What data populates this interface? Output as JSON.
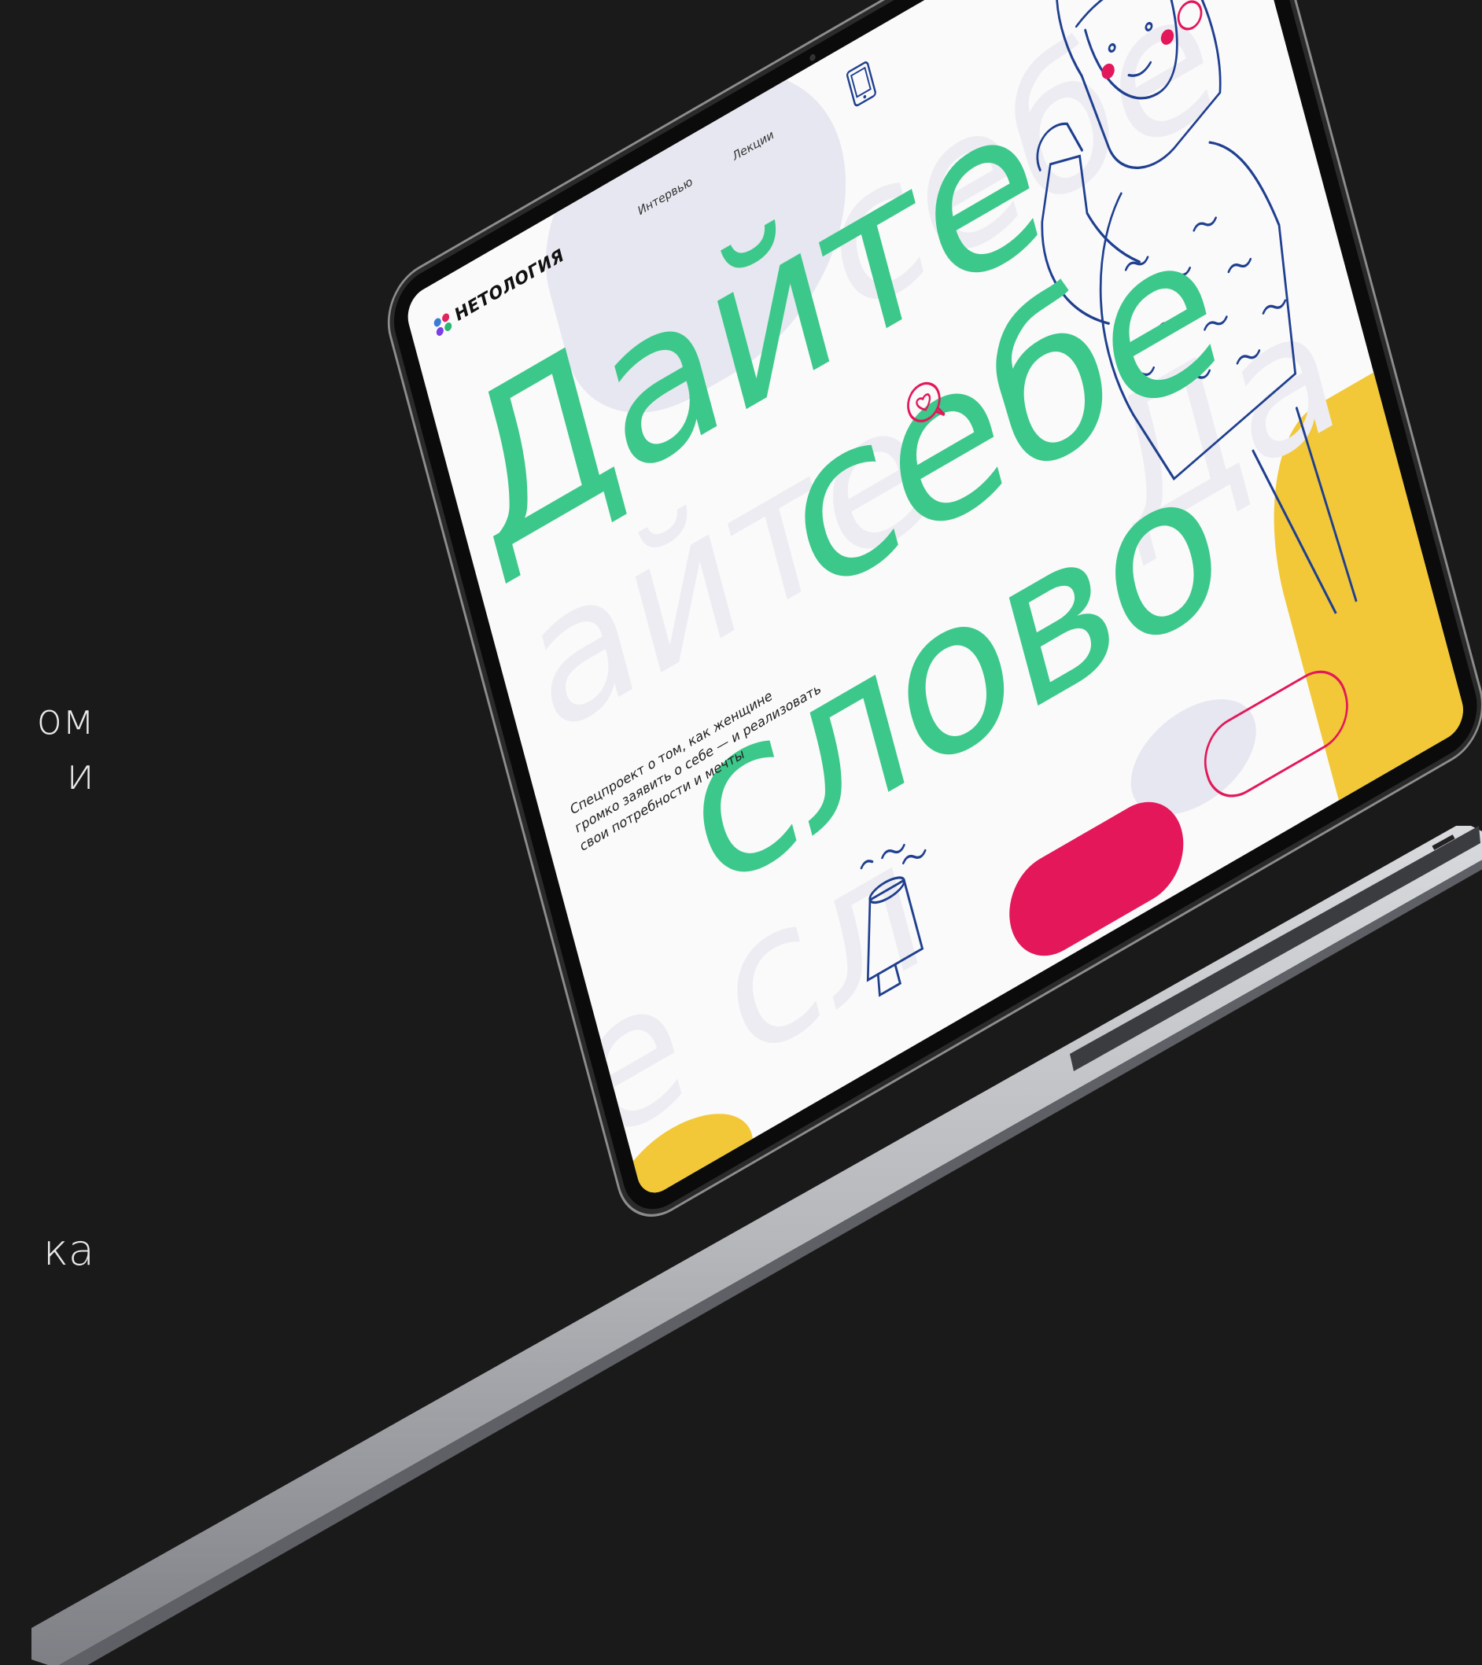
{
  "left_fragments": {
    "top_lines": [
      "ом",
      "и"
    ],
    "bottom_lines": [
      "ка"
    ]
  },
  "site": {
    "logo_text": "НЕТОЛОГИЯ",
    "nav": [
      {
        "label": "Интервью"
      },
      {
        "label": "Лекции"
      }
    ],
    "hero": {
      "line1": "Дайте",
      "line2": "себе",
      "line3": "слово"
    },
    "ghost": {
      "g1": "себе",
      "g2": "айте",
      "g3": "е сл",
      "g4": "Да"
    },
    "subtitle": "Спецпроект о том, как женщине громко заявить о себе — и реализовать свои потребности и мечты",
    "colors": {
      "accent_green": "#3cc88a",
      "accent_pink": "#e3175a",
      "accent_yellow": "#f2c838",
      "line_blue": "#1f3f8f"
    },
    "icons": [
      "phone-icon",
      "heart-bubble-icon",
      "megaphone-icon"
    ]
  }
}
